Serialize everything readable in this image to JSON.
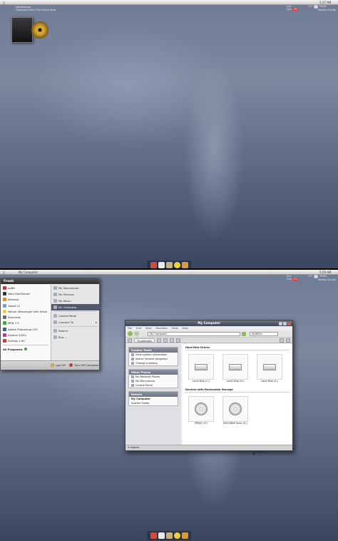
{
  "screen1": {
    "topbar": {
      "logo": "Mac",
      "clock": "5:37 AM"
    },
    "now_playing": {
      "artist": "Darkthrone",
      "line1": "Graveyard Slut",
      "line2": "The Cult is Alive"
    },
    "cpu": {
      "label1": "Sys",
      "label2": "Cpu",
      "value": "0%"
    },
    "weather": {
      "temp": "13°",
      "city": "Perth",
      "desc": "Mostly Cloudy"
    }
  },
  "screen2": {
    "topbar": {
      "app": "My Computer",
      "clock": "5:29 AM"
    },
    "cpu": {
      "label1": "Sys",
      "label2": "Cpu",
      "value": "0%"
    },
    "weather": {
      "temp": "13°",
      "city": "Perth",
      "desc": "Mostly Cloudy"
    },
    "start_menu": {
      "user": "Freak",
      "left_items": [
        "uoBit",
        "Nero StartSmart",
        "Winamp",
        "Tweak UI",
        "Yahoo! Messenger with Voice",
        "Samurize",
        "MSN 7.5",
        "Adobe Photoshop CS2",
        "Alcohol 120%",
        "XnView 1.90"
      ],
      "all_programs": "All Programs",
      "right_items": [
        "My Documents",
        "My Pictures",
        "My Music",
        "My Computer",
        "Control Panel",
        "Connect To",
        "Search",
        "Run..."
      ],
      "log_off": "Log Off",
      "turn_off": "Turn Off Computer"
    },
    "explorer": {
      "title": "My Computer",
      "menu": [
        "File",
        "Edit",
        "View",
        "Favorites",
        "Tools",
        "Help"
      ],
      "address": "My Computer",
      "search": "SEARCH",
      "view_button": "Thumbnails",
      "system_tasks": {
        "title": "System Tasks",
        "items": [
          "View system information",
          "Add or remove programs",
          "Change a setting"
        ]
      },
      "other_places": {
        "title": "Other Places",
        "items": [
          "My Network Places",
          "My Documents",
          "Control Panel"
        ]
      },
      "details": {
        "title": "Details",
        "name": "My Computer",
        "type": "System Folder"
      },
      "hard_disk_header": "Hard Disk Drives",
      "drives": [
        "Local Disk (C:)",
        "Local Disk (D:)",
        "Local Disk (E:)"
      ],
      "removable_header": "Devices with Removable Storage",
      "removable": [
        "PIPA(E) (F:)",
        "DVD-RAM Drive (G:)"
      ],
      "status_left": "5 objects",
      "status_right": "Freak"
    }
  },
  "colors": {
    "wallpaper": "#6f7c95",
    "selection": "#51596a",
    "panel_header": "#7a8090"
  }
}
